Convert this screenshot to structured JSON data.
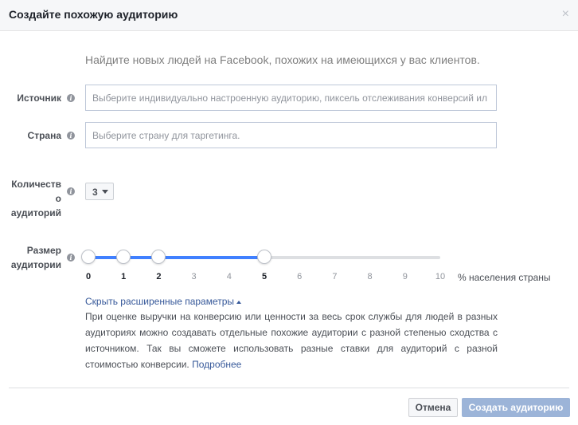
{
  "dialog": {
    "title": "Создайте похожую аудиторию",
    "close_glyph": "×"
  },
  "intro": "Найдите новых людей на Facebook, похожих на имеющихся у вас клиентов.",
  "info_glyph": "i",
  "source": {
    "label": "Источник",
    "placeholder": "Выберите индивидуально настроенную аудиторию, пиксель отслеживания конверсий ил",
    "value": ""
  },
  "country": {
    "label": "Страна",
    "placeholder": "Выберите страну для таргетинга.",
    "value": ""
  },
  "audience_count": {
    "label_line1": "Количеств",
    "label_line2": "о",
    "label_line3": "аудиторий",
    "selected": "3"
  },
  "audience_size": {
    "label_line1": "Размер",
    "label_line2": "аудитории",
    "ticks": [
      "0",
      "1",
      "2",
      "3",
      "4",
      "5",
      "6",
      "7",
      "8",
      "9",
      "10"
    ],
    "min": 0,
    "max": 10,
    "handles": [
      0,
      1,
      2,
      5
    ],
    "unit": "% населения страны",
    "accent": "#4080ff"
  },
  "advanced": {
    "toggle_label": "Скрыть расширенные параметры",
    "help_text": "При оценке выручки на конверсию или ценности за весь срок службы для людей в разных аудиториях можно создавать отдельные похожие аудитории с разной степенью сходства с источником. Так вы сможете использовать разные ставки для аудиторий с разной стоимостью конверсии.",
    "learn_more": "Подробнее"
  },
  "footer": {
    "cancel_label": "Отмена",
    "create_label": "Создать аудиторию"
  }
}
